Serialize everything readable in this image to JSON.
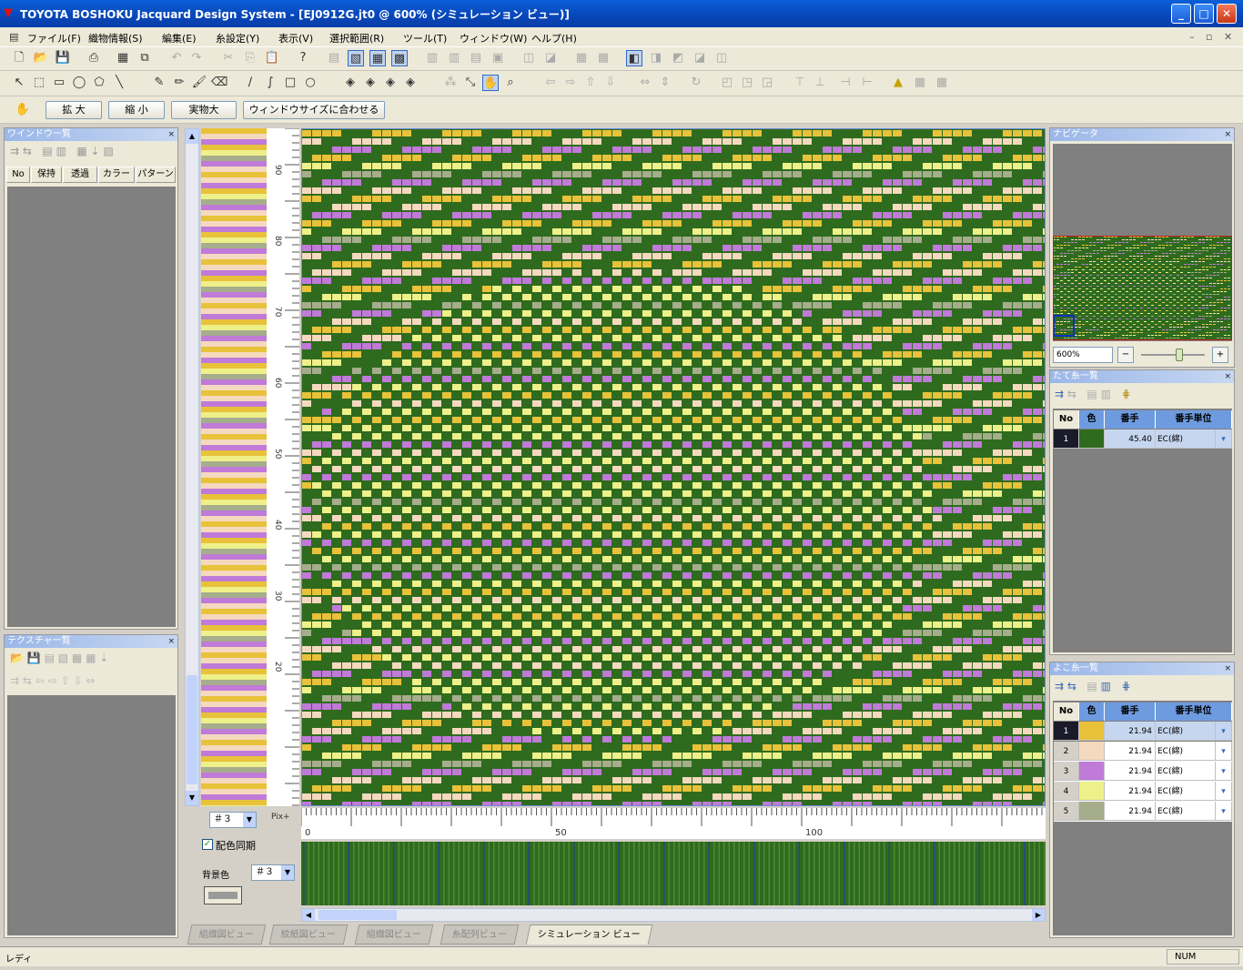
{
  "window": {
    "title": "TOYOTA BOSHOKU Jacquard Design System - [EJ0912G.jt0 @ 600% (シミュレーション ビュー)]"
  },
  "menu": [
    "ファイル(F)",
    "織物情報(S)",
    "編集(E)",
    "糸設定(Y)",
    "表示(V)",
    "選択範囲(R)",
    "ツール(T)",
    "ウィンドウ(W)",
    "ヘルプ(H)"
  ],
  "zoom_buttons": {
    "zoom_in": "拡 大",
    "zoom_out": "縮 小",
    "actual": "実物大",
    "fit": "ウィンドウサイズに合わせる"
  },
  "left_panel_top": {
    "title": "ワインドウ一覧",
    "columns": [
      "No",
      "保持",
      "透過",
      "カラー",
      "パターン"
    ]
  },
  "left_panel_bottom": {
    "title": "テクスチャ一覧"
  },
  "ruler": {
    "left_marks": [
      "90",
      "80",
      "70",
      "60",
      "50",
      "40",
      "30",
      "20"
    ],
    "bottom_marks": [
      "0",
      "50",
      "100"
    ]
  },
  "controls": {
    "repeat_select": "＃３",
    "pix_label": "Pix+",
    "sync_checkbox": "配色同期",
    "bg_color_label": "背景色",
    "bg_color_select": "＃３"
  },
  "navigator": {
    "title": "ナビゲータ",
    "zoom_value": "600%"
  },
  "warp_panel": {
    "title": "たて糸一覧",
    "columns": [
      "No",
      "色",
      "番手",
      "番手単位"
    ],
    "rows": [
      {
        "no": "1",
        "color": "#2e6b1e",
        "count": "45.40",
        "unit": "EC(綿)"
      }
    ]
  },
  "weft_panel": {
    "title": "よこ糸一覧",
    "columns": [
      "No",
      "色",
      "番手",
      "番手単位"
    ],
    "rows": [
      {
        "no": "1",
        "color": "#e8c23a",
        "count": "21.94",
        "unit": "EC(綿)"
      },
      {
        "no": "2",
        "color": "#f5d9bf",
        "count": "21.94",
        "unit": "EC(綿)"
      },
      {
        "no": "3",
        "color": "#c07ad8",
        "count": "21.94",
        "unit": "EC(綿)"
      },
      {
        "no": "4",
        "color": "#eef08a",
        "count": "21.94",
        "unit": "EC(綿)"
      },
      {
        "no": "5",
        "color": "#a6ad8c",
        "count": "21.94",
        "unit": "EC(綿)"
      }
    ]
  },
  "tabs": [
    "組織図ビュー",
    "紋紙図ビュー",
    "組織図ビュー",
    "糸配列ビュー",
    "シミュレーション ビュー"
  ],
  "status": {
    "left": "レディ",
    "right": "NUM"
  },
  "fabric_colors": {
    "warp": "#2e6b1e",
    "gold": "#e8c23a",
    "pink": "#c07ad8",
    "cream": "#f5d9bf",
    "yellow": "#eef08a",
    "sage": "#a6ad8c"
  }
}
